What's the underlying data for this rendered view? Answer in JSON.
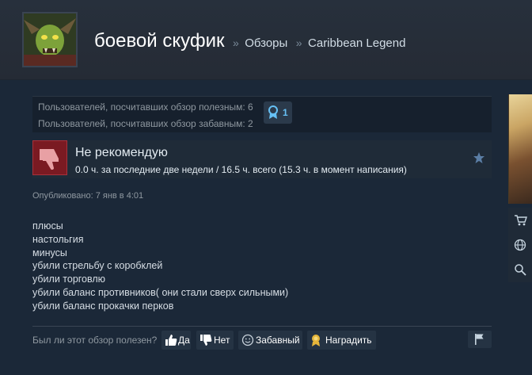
{
  "header": {
    "user_name": "боевой скуфик",
    "separator": "»",
    "breadcrumb_reviews": "Обзоры",
    "breadcrumb_game": "Caribbean Legend"
  },
  "stats": {
    "helpful_line": "Пользователей, посчитавших обзор полезным: 6",
    "funny_line": "Пользователей, посчитавших обзор забавным: 2",
    "award_count": "1"
  },
  "verdict": {
    "title": "Не рекомендую",
    "hours": "0.0 ч. за последние две недели / 16.5 ч. всего (15.3 ч. в момент написания)"
  },
  "published": "Опубликовано: 7 янв в 4:01",
  "review_lines": [
    "плюсы",
    "настольгия",
    "минусы",
    "убили стрельбу с коробклей",
    "убили торговлю",
    "убили баланс противников( они стали сверх сильными)",
    "убили баланс прокачки перков"
  ],
  "rating": {
    "question": "Был ли этот обзор полезен?",
    "yes_label": "Да",
    "no_label": "Нет",
    "funny_label": "Забавный",
    "award_label": "Наградить"
  },
  "icons": {
    "thumbs_down": "thumbs-down-icon",
    "star": "star-icon",
    "ribbon": "ribbon-icon",
    "flag": "flag-icon",
    "cart": "cart-icon",
    "globe": "globe-icon",
    "search": "search-icon"
  },
  "colors": {
    "background": "#1b2838",
    "accent_blue": "#66c0f4",
    "not_recommended": "#7a1a22",
    "award_gold": "#e5b53a"
  }
}
